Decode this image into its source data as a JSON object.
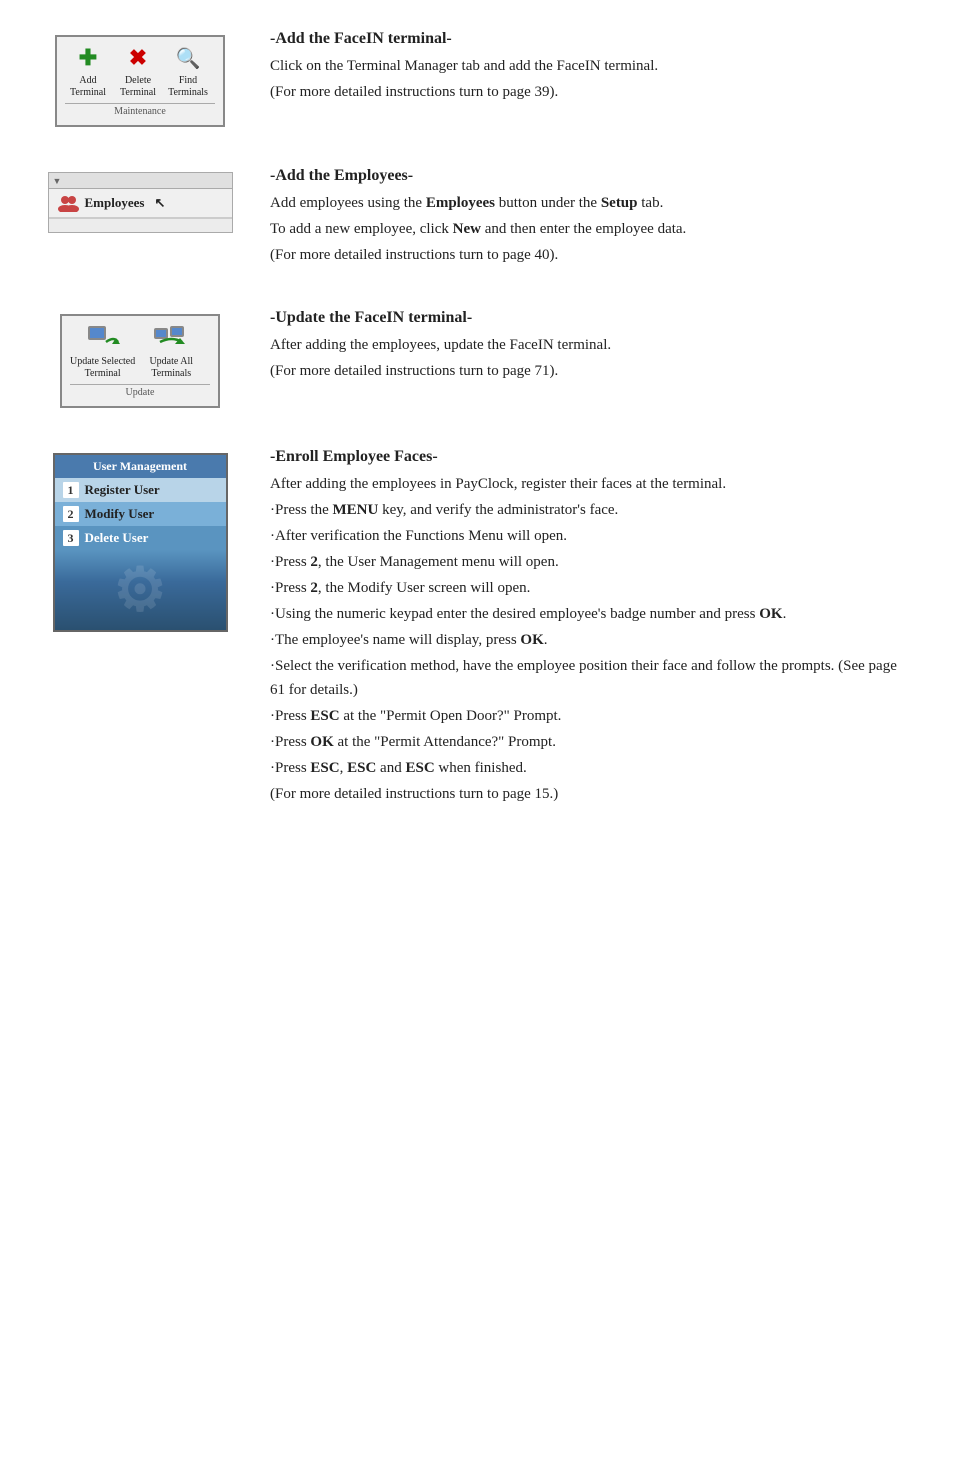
{
  "sections": [
    {
      "id": "add-facein-terminal",
      "title": "-Add the FaceIN terminal-",
      "paragraphs": [
        "Click on the Terminal Manager tab and add the FaceIN terminal.",
        "(For more detailed instructions turn to page 39)."
      ]
    },
    {
      "id": "add-employees",
      "title": "-Add the Employees-",
      "paragraphs": [
        "Add employees using the",
        "Employees button under the Setup tab.",
        "To add a new employee, click New and then enter the employee data.",
        "(For more detailed instructions turn to page 40)."
      ]
    },
    {
      "id": "update-facein-terminal",
      "title": "-Update the FaceIN terminal-",
      "paragraphs": [
        "After adding the employees, update the FaceIN terminal.",
        " (For more detailed instructions turn to page 71)."
      ]
    },
    {
      "id": "enroll-employee-faces",
      "title": "-Enroll Employee Faces-",
      "paragraphs": [
        "After adding the employees in PayClock, register their faces at the terminal.",
        "·Press the MENU key, and verify the administrator's face.",
        "·After verification the Functions Menu will open.",
        "·Press 2, the User Management menu will open.",
        "·Press 2, the Modify User screen will open.",
        "·Using the numeric keypad enter the desired employee's badge number and press OK.",
        "·The employee's name will display, press OK.",
        "·Select the verification method, have the employee position their face and follow the prompts. (See page 61 for details.)",
        "·Press ESC at the \"Permit Open Door?\" Prompt.",
        "·Press OK at the \"Permit Attendance?\" Prompt.",
        "·Press ESC, ESC and ESC when finished.",
        "(For more detailed instructions turn to page 15.)"
      ]
    }
  ],
  "toolbar": {
    "add_label": "Add\nTerminal",
    "delete_label": "Delete\nTerminal",
    "find_label": "Find\nTerminals",
    "group_label": "Maintenance"
  },
  "nav": {
    "employees_label": "Employees"
  },
  "update": {
    "sel_label": "Update Selected\nTerminal",
    "all_label": "Update All\nTerminals",
    "group_label": "Update"
  },
  "usermgmt": {
    "title": "User Management",
    "item1": "Register User",
    "item2": "Modify User",
    "item3": "Delete User"
  }
}
